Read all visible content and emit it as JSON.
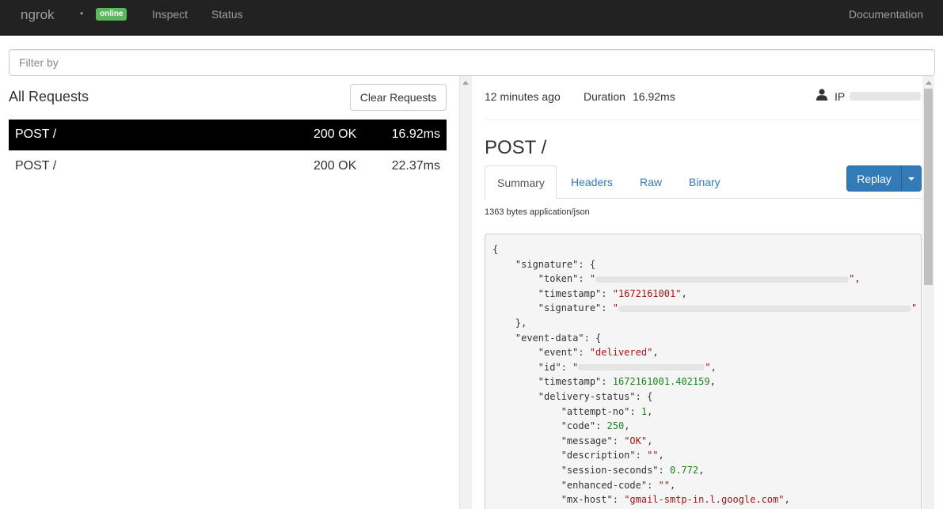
{
  "navbar": {
    "brand": "ngrok",
    "dot": "•",
    "status_badge": "online",
    "links": [
      "Inspect",
      "Status"
    ],
    "docs": "Documentation"
  },
  "filter": {
    "placeholder": "Filter by"
  },
  "requests": {
    "title": "All Requests",
    "clear_label": "Clear Requests",
    "rows": [
      {
        "method": "POST /",
        "status": "200 OK",
        "duration": "16.92ms",
        "selected": true
      },
      {
        "method": "POST /",
        "status": "200 OK",
        "duration": "22.37ms",
        "selected": false
      }
    ]
  },
  "detail": {
    "time_ago": "12 minutes ago",
    "duration_label": "Duration",
    "duration_value": "16.92ms",
    "ip_label": "IP",
    "heading": "POST /",
    "tabs": [
      "Summary",
      "Headers",
      "Raw",
      "Binary"
    ],
    "active_tab": "Summary",
    "replay_label": "Replay",
    "size_info": "1363 bytes application/json",
    "json": {
      "open_brace": "{",
      "signature_key": "\"signature\"",
      "token_key": "\"token\"",
      "timestamp_key": "\"timestamp\"",
      "timestamp_value": "\"1672161001\"",
      "signature_inner_key": "\"signature\"",
      "event_data_key": "\"event-data\"",
      "event_key": "\"event\"",
      "event_value": "\"delivered\"",
      "id_key": "\"id\"",
      "ed_timestamp_key": "\"timestamp\"",
      "ed_timestamp_value": "1672161001.402159",
      "delivery_status_key": "\"delivery-status\"",
      "attempt_key": "\"attempt-no\"",
      "attempt_value": "1",
      "code_key": "\"code\"",
      "code_value": "250",
      "message_key": "\"message\"",
      "message_value": "\"OK\"",
      "description_key": "\"description\"",
      "description_value": "\"\"",
      "session_key": "\"session-seconds\"",
      "session_value": "0.772",
      "enhanced_key": "\"enhanced-code\"",
      "enhanced_value": "\"\"",
      "mx_key": "\"mx-host\"",
      "mx_value": "\"gmail-smtp-in.l.google.com\""
    }
  },
  "icons": {
    "user": "user-icon",
    "caret": "caret-down-icon"
  }
}
